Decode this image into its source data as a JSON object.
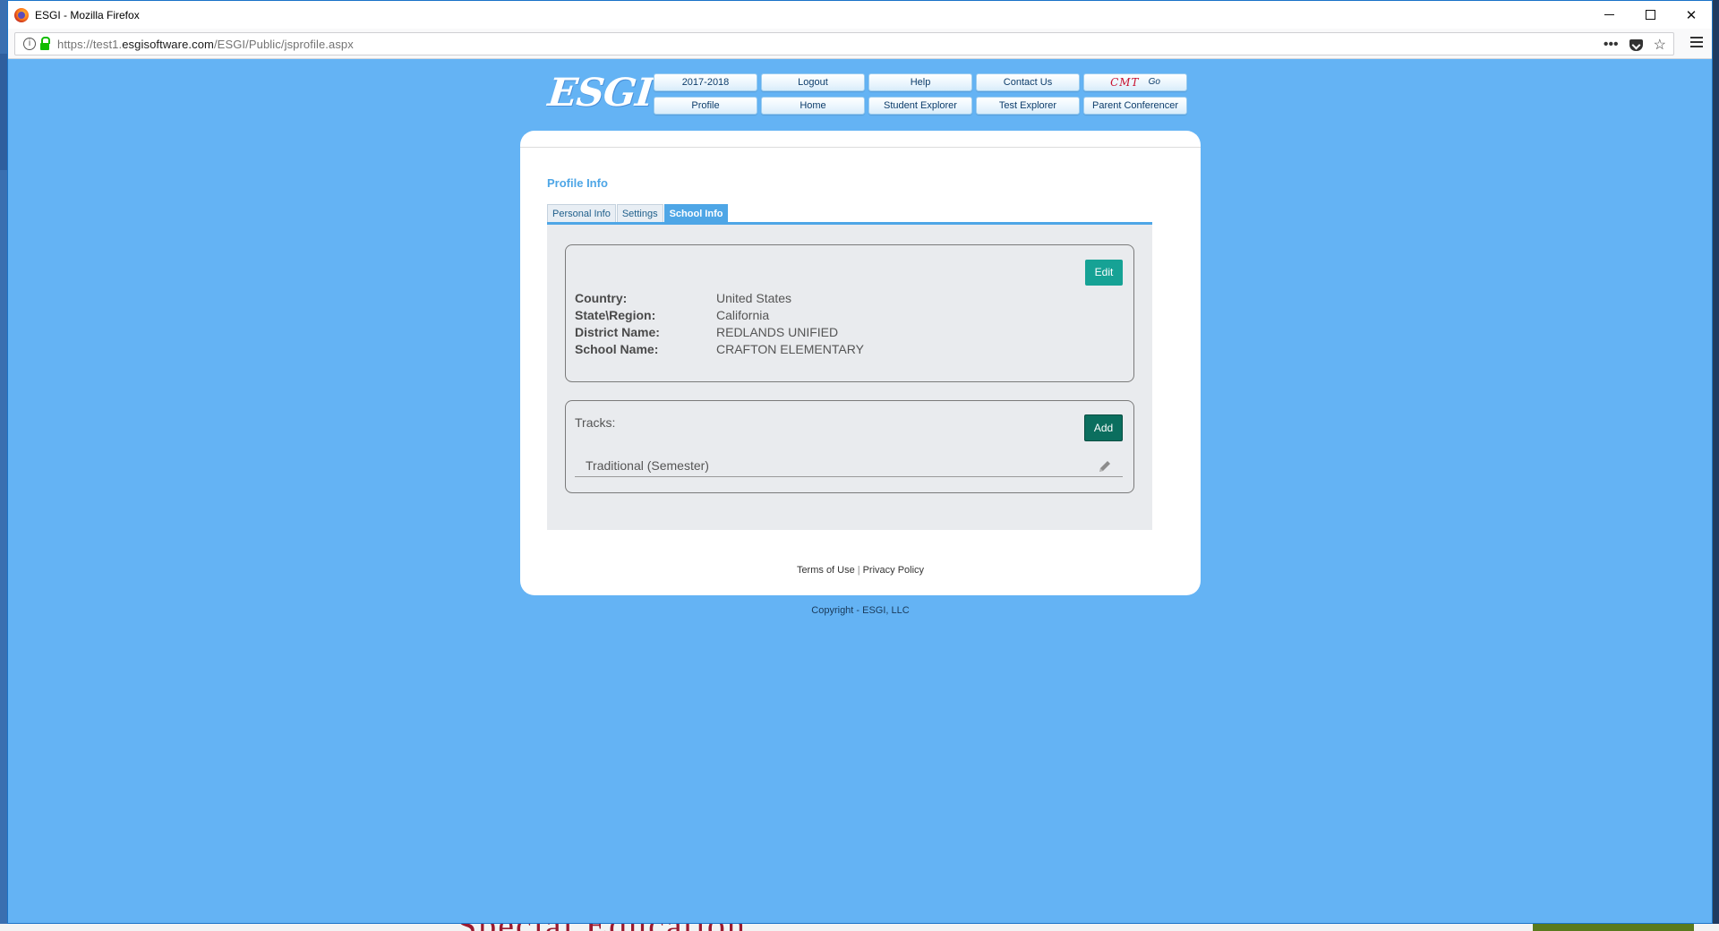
{
  "window": {
    "title": "ESGI - Mozilla Firefox",
    "url_prefix": "https://test1.",
    "url_host": "esgisoftware.com",
    "url_path": "/ESGI/Public/jsprofile.aspx"
  },
  "logo": {
    "text": "ESGI"
  },
  "nav": {
    "row1": [
      "2017-2018",
      "Logout",
      "Help",
      "Contact Us"
    ],
    "cmt_label": "CMT",
    "cmt_go": "Go",
    "row2": [
      "Profile",
      "Home",
      "Student Explorer",
      "Test Explorer",
      "Parent Conferencer"
    ]
  },
  "profile": {
    "title": "Profile Info",
    "tabs": [
      "Personal Info",
      "Settings",
      "School Info"
    ],
    "active_tab": "School Info"
  },
  "school_info": {
    "edit_label": "Edit",
    "rows": [
      {
        "label": "Country:",
        "value": "United States"
      },
      {
        "label": "State\\Region:",
        "value": "California"
      },
      {
        "label": "District Name:",
        "value": "REDLANDS UNIFIED"
      },
      {
        "label": "School Name:",
        "value": "CRAFTON ELEMENTARY"
      }
    ]
  },
  "tracks": {
    "label": "Tracks:",
    "add_label": "Add",
    "items": [
      "Traditional (Semester)"
    ]
  },
  "footer": {
    "terms": "Terms of Use",
    "separator": "|",
    "privacy": "Privacy Policy",
    "copyright": "Copyright - ESGI, LLC"
  },
  "background": {
    "partial_text": "Special Education"
  },
  "colors": {
    "page_bg": "#64b3f4",
    "accent": "#4ea6e6",
    "edit_button": "#16a295",
    "add_button": "#0b6e5e"
  }
}
